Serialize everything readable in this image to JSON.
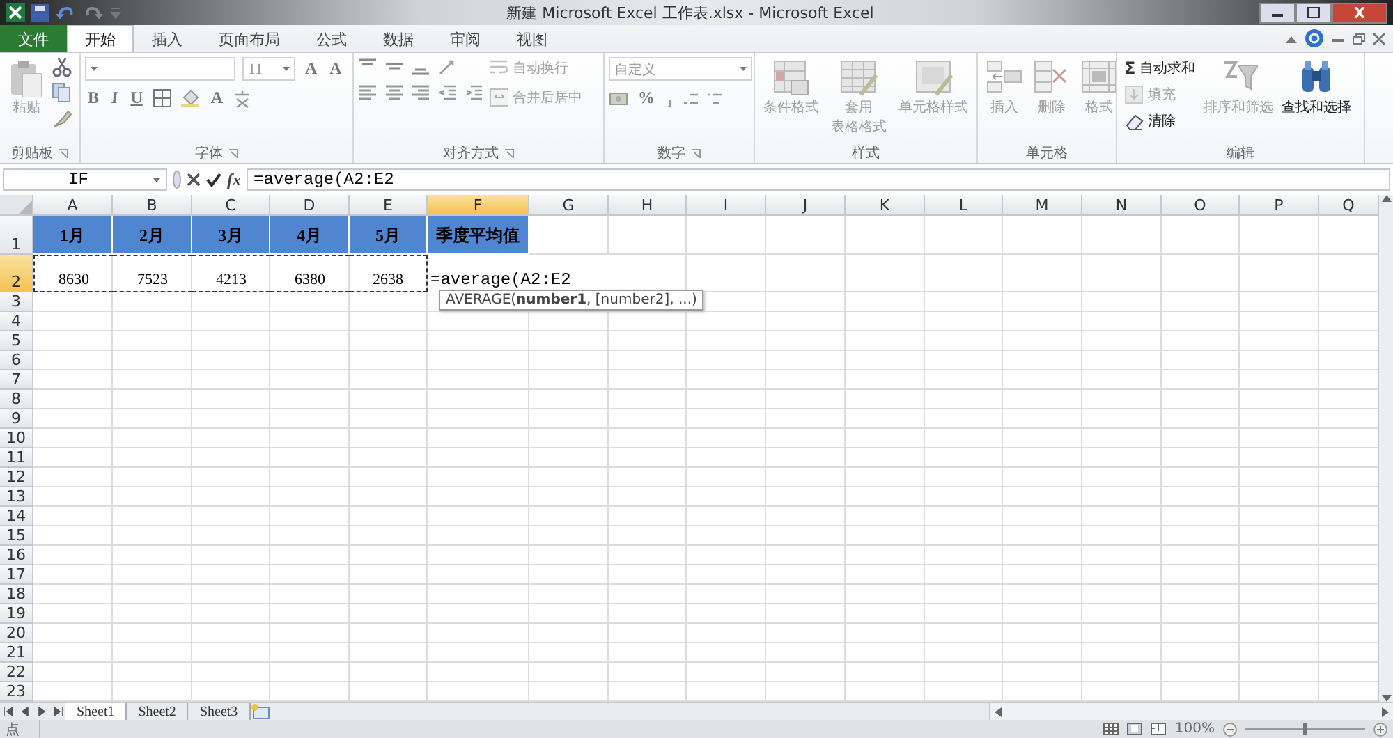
{
  "window": {
    "title": "新建 Microsoft Excel 工作表.xlsx - Microsoft Excel"
  },
  "tabs": [
    {
      "label": "文件",
      "kind": "file",
      "selected": false
    },
    {
      "label": "开始",
      "kind": "tab",
      "selected": true
    },
    {
      "label": "插入",
      "kind": "tab",
      "selected": false
    },
    {
      "label": "页面布局",
      "kind": "tab",
      "selected": false
    },
    {
      "label": "公式",
      "kind": "tab",
      "selected": false
    },
    {
      "label": "数据",
      "kind": "tab",
      "selected": false
    },
    {
      "label": "审阅",
      "kind": "tab",
      "selected": false
    },
    {
      "label": "视图",
      "kind": "tab",
      "selected": false
    }
  ],
  "ribbon": {
    "groups": [
      {
        "kind": "clipboard",
        "label": "剪贴板",
        "items": [
          {
            "label": "粘贴",
            "disabled": true
          }
        ]
      },
      {
        "kind": "font",
        "label": "字体",
        "font_size": "11",
        "glyphs": [
          "A",
          "A",
          "B",
          "I",
          "U",
          "A"
        ]
      },
      {
        "kind": "alignment",
        "label": "对齐方式",
        "items": [
          {
            "label": "自动换行",
            "disabled": true
          },
          {
            "label": "合并后居中",
            "disabled": true
          }
        ]
      },
      {
        "kind": "number",
        "label": "数字",
        "format": "自定义",
        "glyphs": [
          "%"
        ]
      },
      {
        "kind": "large",
        "label": "样式",
        "items": [
          {
            "label": "条件格式",
            "disabled": true
          },
          {
            "lines": [
              "套用",
              "表格格式"
            ],
            "disabled": true
          },
          {
            "label": "单元格样式",
            "disabled": true
          }
        ]
      },
      {
        "kind": "large",
        "label": "单元格",
        "items": [
          {
            "label": "插入",
            "disabled": true
          },
          {
            "label": "删除",
            "disabled": true
          },
          {
            "label": "格式",
            "disabled": true
          }
        ]
      },
      {
        "kind": "editing",
        "label": "编辑",
        "small": [
          {
            "icon": "Σ",
            "label": "自动求和",
            "disabled": false
          },
          {
            "label": "填充",
            "disabled": true
          },
          {
            "label": "清除",
            "disabled": false
          }
        ],
        "items": [
          {
            "label": "排序和筛选",
            "disabled": true
          },
          {
            "label": "查找和选择",
            "disabled": false
          }
        ]
      }
    ]
  },
  "formula_bar": {
    "name_box": "IF",
    "function_button": "fx",
    "formula": "=average(A2:E2"
  },
  "sheet": {
    "columns": [
      {
        "label": "A",
        "selected": false
      },
      {
        "label": "B",
        "selected": false
      },
      {
        "label": "C",
        "selected": false
      },
      {
        "label": "D",
        "selected": false
      },
      {
        "label": "E",
        "selected": false
      },
      {
        "label": "F",
        "selected": true
      },
      {
        "label": "G",
        "selected": false
      },
      {
        "label": "H",
        "selected": false
      },
      {
        "label": "I",
        "selected": false
      },
      {
        "label": "J",
        "selected": false
      },
      {
        "label": "K",
        "selected": false
      },
      {
        "label": "L",
        "selected": false
      },
      {
        "label": "M",
        "selected": false
      },
      {
        "label": "N",
        "selected": false
      },
      {
        "label": "O",
        "selected": false
      },
      {
        "label": "P",
        "selected": false
      },
      {
        "label": "Q",
        "selected": false
      }
    ],
    "rows": [
      {
        "number": "1",
        "selected": false,
        "cells": [
          {
            "text": "1月",
            "kind": "header",
            "referenced": false
          },
          {
            "text": "2月",
            "kind": "header",
            "referenced": false
          },
          {
            "text": "3月",
            "kind": "header",
            "referenced": false
          },
          {
            "text": "4月",
            "kind": "header",
            "referenced": false
          },
          {
            "text": "5月",
            "kind": "header",
            "referenced": false
          },
          {
            "text": "季度平均值",
            "kind": "header",
            "referenced": false
          }
        ]
      },
      {
        "number": "2",
        "selected": true,
        "cells": [
          {
            "text": "8630",
            "kind": "value",
            "referenced": true
          },
          {
            "text": "7523",
            "kind": "value",
            "referenced": true
          },
          {
            "text": "4213",
            "kind": "value",
            "referenced": true
          },
          {
            "text": "6380",
            "kind": "value",
            "referenced": true
          },
          {
            "text": "2638",
            "kind": "value",
            "referenced": true
          },
          {
            "text": "=average(A2:E2",
            "kind": "editing",
            "referenced": false
          }
        ]
      },
      {
        "number": "3",
        "selected": false
      },
      {
        "number": "4",
        "selected": false
      },
      {
        "number": "5",
        "selected": false
      },
      {
        "number": "6",
        "selected": false
      },
      {
        "number": "7",
        "selected": false
      },
      {
        "number": "8",
        "selected": false
      },
      {
        "number": "9",
        "selected": false
      },
      {
        "number": "10",
        "selected": false
      },
      {
        "number": "11",
        "selected": false
      },
      {
        "number": "12",
        "selected": false
      },
      {
        "number": "13",
        "selected": false
      },
      {
        "number": "14",
        "selected": false
      },
      {
        "number": "15",
        "selected": false
      },
      {
        "number": "16",
        "selected": false
      },
      {
        "number": "17",
        "selected": false
      },
      {
        "number": "18",
        "selected": false
      },
      {
        "number": "19",
        "selected": false
      },
      {
        "number": "20",
        "selected": false
      },
      {
        "number": "21",
        "selected": false
      },
      {
        "number": "22",
        "selected": false
      },
      {
        "number": "23",
        "selected": false
      }
    ],
    "tooltip": "AVERAGE(**number1**, [number2], ...)"
  },
  "sheet_tabs": [
    {
      "label": "Sheet1",
      "selected": true
    },
    {
      "label": "Sheet2",
      "selected": false
    },
    {
      "label": "Sheet3",
      "selected": false
    }
  ],
  "status_bar": {
    "mode": "点",
    "zoom": "100%",
    "zoom_slider": {
      "level": 0.5
    }
  }
}
